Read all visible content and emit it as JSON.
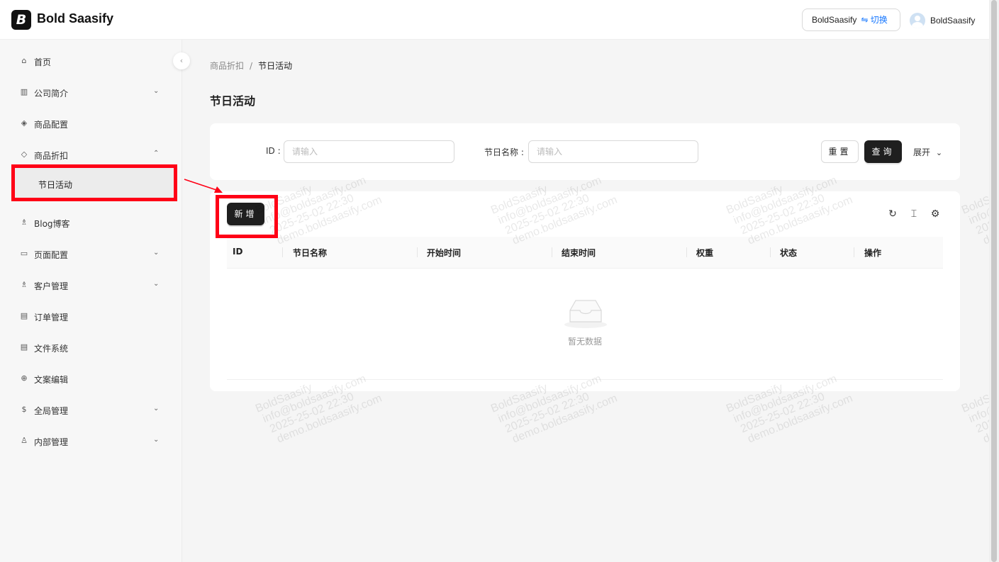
{
  "header": {
    "logo_glyph": "B",
    "app_name": "Bold Saasify",
    "tenant": {
      "name": "BoldSaasify",
      "switch_label": "⇋ 切换"
    },
    "user": {
      "name": "BoldSaasify"
    }
  },
  "sidebar": {
    "items": [
      {
        "label": "首页",
        "icon": "home-icon",
        "glyph": "⌂",
        "expandable": false
      },
      {
        "label": "公司简介",
        "icon": "building-icon",
        "glyph": "▥",
        "expandable": true,
        "arrow": "⌄"
      },
      {
        "label": "商品配置",
        "icon": "box-icon",
        "glyph": "◈",
        "expandable": false
      },
      {
        "label": "商品折扣",
        "icon": "tag-icon",
        "glyph": "◇",
        "expandable": true,
        "arrow": "⌃"
      },
      {
        "label": "Blog博客",
        "icon": "users-icon",
        "glyph": "♗",
        "expandable": false
      },
      {
        "label": "页面配置",
        "icon": "monitor-icon",
        "glyph": "▭",
        "expandable": true,
        "arrow": "⌄"
      },
      {
        "label": "客户管理",
        "icon": "team-icon",
        "glyph": "♗",
        "expandable": true,
        "arrow": "⌄"
      },
      {
        "label": "订单管理",
        "icon": "order-icon",
        "glyph": "▤",
        "expandable": false
      },
      {
        "label": "文件系统",
        "icon": "file-icon",
        "glyph": "▤",
        "expandable": false
      },
      {
        "label": "文案编辑",
        "icon": "globe-icon",
        "glyph": "⊕",
        "expandable": false
      },
      {
        "label": "全局管理",
        "icon": "dollar-icon",
        "glyph": "$",
        "expandable": true,
        "arrow": "⌄"
      },
      {
        "label": "内部管理",
        "icon": "user-icon",
        "glyph": "♙",
        "expandable": true,
        "arrow": "⌄"
      }
    ],
    "active_submenu": {
      "label": "节日活动"
    },
    "collapse_glyph": "‹"
  },
  "breadcrumb": {
    "parent": "商品折扣",
    "separator": "/",
    "current": "节日活动"
  },
  "page_title": "节日活动",
  "search": {
    "id_label": "ID :",
    "id_placeholder": "请输入",
    "name_label": "节日名称 :",
    "name_placeholder": "请输入",
    "reset_label": "重置",
    "query_label": "查询",
    "expand_label": "展开",
    "expand_glyph": "⌄"
  },
  "table": {
    "add_label": "新增",
    "tool_glyphs": {
      "reload": "↻",
      "density": "⌶",
      "settings": "⚙"
    },
    "columns": [
      "ID",
      "节日名称",
      "开始时间",
      "结束时间",
      "权重",
      "状态",
      "操作"
    ],
    "rows": [],
    "empty_text": "暂无数据"
  },
  "watermark": {
    "lines": [
      "BoldSaasify",
      "info@boldsaasify.com",
      "2025-25-02 22:30",
      "demo.boldsaasify.com"
    ]
  },
  "colors": {
    "accent": "#1f1f1f",
    "link": "#1677ff",
    "annotation": "#ff0016"
  }
}
